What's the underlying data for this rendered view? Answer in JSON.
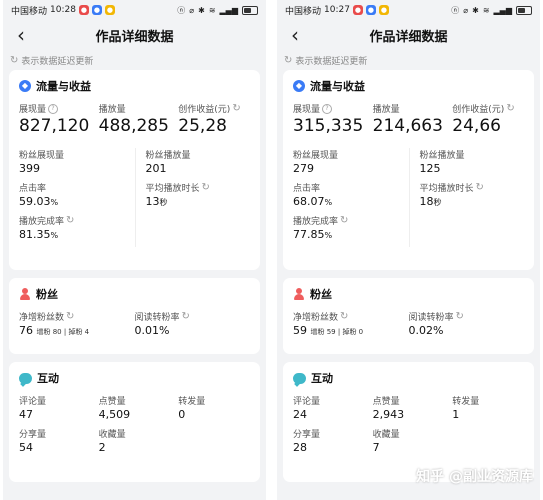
{
  "phones": [
    {
      "status": {
        "carrier": "中国移动",
        "time": "10:28",
        "right_text": "ⓝ 🔕 ✱ ⊗ ᯤ ▮"
      },
      "title": "作品详细数据",
      "delay_note": "表示数据延迟更新",
      "traffic": {
        "heading": "流量与收益",
        "exposure_label": "展现量",
        "exposure": "827,120",
        "plays_label": "播放量",
        "plays": "488,285",
        "income_label": "创作收益(元)",
        "income": "25,28",
        "fan_exposure_label": "粉丝展现量",
        "fan_exposure": "399",
        "fan_plays_label": "粉丝播放量",
        "fan_plays": "201",
        "ctr_label": "点击率",
        "ctr": "59.03",
        "avg_play_label": "平均播放时长",
        "avg_play": "13",
        "completion_label": "播放完成率",
        "completion": "81.35"
      },
      "fans": {
        "heading": "粉丝",
        "net_label": "净增粉丝数",
        "net": "76",
        "gain": "增粉 80",
        "loss": "掉粉 4",
        "conv_label": "阅读转粉率",
        "conv": "0.01%"
      },
      "interaction": {
        "heading": "互动",
        "comments_label": "评论量",
        "comments": "47",
        "likes_label": "点赞量",
        "likes": "4,509",
        "forwards_label": "转发量",
        "forwards": "0",
        "shares_label": "分享量",
        "shares": "54",
        "favs_label": "收藏量",
        "favs": "2"
      }
    },
    {
      "status": {
        "carrier": "中国移动",
        "time": "10:27",
        "right_text": "ⓝ 🔕 ✱ ⊗ ᯤ ▮"
      },
      "title": "作品详细数据",
      "delay_note": "表示数据延迟更新",
      "traffic": {
        "heading": "流量与收益",
        "exposure_label": "展现量",
        "exposure": "315,335",
        "plays_label": "播放量",
        "plays": "214,663",
        "income_label": "创作收益(元)",
        "income": "24,66",
        "fan_exposure_label": "粉丝展现量",
        "fan_exposure": "279",
        "fan_plays_label": "粉丝播放量",
        "fan_plays": "125",
        "ctr_label": "点击率",
        "ctr": "68.07",
        "avg_play_label": "平均播放时长",
        "avg_play": "18",
        "completion_label": "播放完成率",
        "completion": "77.85"
      },
      "fans": {
        "heading": "粉丝",
        "net_label": "净增粉丝数",
        "net": "59",
        "gain": "增粉 59",
        "loss": "掉粉 0",
        "conv_label": "阅读转粉率",
        "conv": "0.02%"
      },
      "interaction": {
        "heading": "互动",
        "comments_label": "评论量",
        "comments": "24",
        "likes_label": "点赞量",
        "likes": "2,943",
        "forwards_label": "转发量",
        "forwards": "1",
        "shares_label": "分享量",
        "shares": "28",
        "favs_label": "收藏量",
        "favs": "7"
      }
    }
  ],
  "units": {
    "percent": "%",
    "seconds": "秒"
  },
  "watermark": "知乎 @副业资源库"
}
